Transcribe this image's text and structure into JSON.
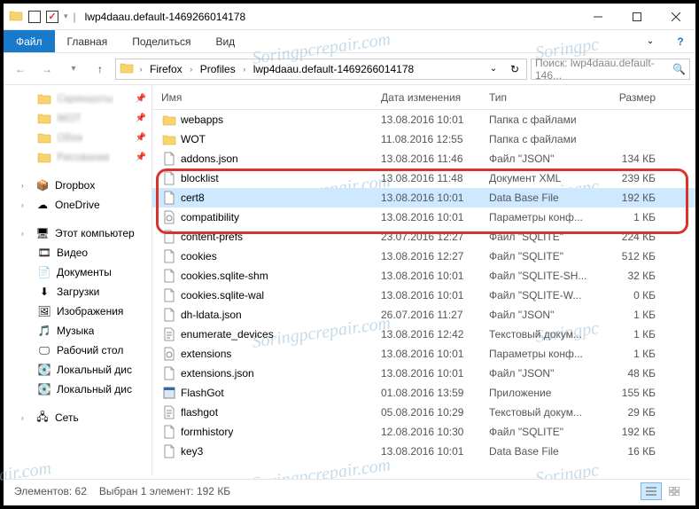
{
  "window": {
    "title": "lwp4daau.default-1469266014178"
  },
  "ribbon": {
    "file": "Файл",
    "tabs": [
      "Главная",
      "Поделиться",
      "Вид"
    ]
  },
  "breadcrumbs": [
    "Firefox",
    "Profiles",
    "lwp4daau.default-1469266014178"
  ],
  "search": {
    "placeholder": "Поиск: lwp4daau.default-146..."
  },
  "sidebar": {
    "quick": [
      {
        "label": "Скриншоты",
        "icon": "folder",
        "blur": true,
        "pin": true
      },
      {
        "label": "WOT",
        "icon": "folder",
        "blur": true,
        "pin": true
      },
      {
        "label": "Обои",
        "icon": "folder",
        "blur": true,
        "pin": true
      },
      {
        "label": "Рисование",
        "icon": "folder",
        "blur": true,
        "pin": true
      }
    ],
    "cloud": [
      {
        "label": "Dropbox",
        "icon": "dropbox"
      },
      {
        "label": "OneDrive",
        "icon": "onedrive"
      }
    ],
    "pc": {
      "label": "Этот компьютер"
    },
    "pc_items": [
      {
        "label": "Видео",
        "icon": "video"
      },
      {
        "label": "Документы",
        "icon": "docs"
      },
      {
        "label": "Загрузки",
        "icon": "downloads"
      },
      {
        "label": "Изображения",
        "icon": "images"
      },
      {
        "label": "Музыка",
        "icon": "music"
      },
      {
        "label": "Рабочий стол",
        "icon": "desktop"
      },
      {
        "label": "Локальный дис",
        "icon": "disk"
      },
      {
        "label": "Локальный дис",
        "icon": "disk"
      }
    ],
    "network": {
      "label": "Сеть"
    }
  },
  "columns": {
    "name": "Имя",
    "date": "Дата изменения",
    "type": "Тип",
    "size": "Размер"
  },
  "files": [
    {
      "name": "webapps",
      "date": "13.08.2016 10:01",
      "type": "Папка с файлами",
      "size": "",
      "icon": "folder"
    },
    {
      "name": "WOT",
      "date": "11.08.2016 12:55",
      "type": "Папка с файлами",
      "size": "",
      "icon": "folder"
    },
    {
      "name": "addons.json",
      "date": "13.08.2016 11:46",
      "type": "Файл \"JSON\"",
      "size": "134 КБ",
      "icon": "file"
    },
    {
      "name": "blocklist",
      "date": "13.08.2016 11:48",
      "type": "Документ XML",
      "size": "239 КБ",
      "icon": "file"
    },
    {
      "name": "cert8",
      "date": "13.08.2016 10:01",
      "type": "Data Base File",
      "size": "192 КБ",
      "icon": "file",
      "selected": true
    },
    {
      "name": "compatibility",
      "date": "13.08.2016 10:01",
      "type": "Параметры конф...",
      "size": "1 КБ",
      "icon": "ini"
    },
    {
      "name": "content-prefs",
      "date": "23.07.2016 12:27",
      "type": "Файл \"SQLITE\"",
      "size": "224 КБ",
      "icon": "file"
    },
    {
      "name": "cookies",
      "date": "13.08.2016 12:27",
      "type": "Файл \"SQLITE\"",
      "size": "512 КБ",
      "icon": "file"
    },
    {
      "name": "cookies.sqlite-shm",
      "date": "13.08.2016 10:01",
      "type": "Файл \"SQLITE-SH...",
      "size": "32 КБ",
      "icon": "file"
    },
    {
      "name": "cookies.sqlite-wal",
      "date": "13.08.2016 10:01",
      "type": "Файл \"SQLITE-W...",
      "size": "0 КБ",
      "icon": "file"
    },
    {
      "name": "dh-ldata.json",
      "date": "26.07.2016 11:27",
      "type": "Файл \"JSON\"",
      "size": "1 КБ",
      "icon": "file"
    },
    {
      "name": "enumerate_devices",
      "date": "13.08.2016 12:42",
      "type": "Текстовый докум...",
      "size": "1 КБ",
      "icon": "txt"
    },
    {
      "name": "extensions",
      "date": "13.08.2016 10:01",
      "type": "Параметры конф...",
      "size": "1 КБ",
      "icon": "ini"
    },
    {
      "name": "extensions.json",
      "date": "13.08.2016 10:01",
      "type": "Файл \"JSON\"",
      "size": "48 КБ",
      "icon": "file"
    },
    {
      "name": "FlashGot",
      "date": "01.08.2016 13:59",
      "type": "Приложение",
      "size": "155 КБ",
      "icon": "exe"
    },
    {
      "name": "flashgot",
      "date": "05.08.2016 10:29",
      "type": "Текстовый докум...",
      "size": "29 КБ",
      "icon": "txt"
    },
    {
      "name": "formhistory",
      "date": "12.08.2016 10:30",
      "type": "Файл \"SQLITE\"",
      "size": "192 КБ",
      "icon": "file"
    },
    {
      "name": "key3",
      "date": "13.08.2016 10:01",
      "type": "Data Base File",
      "size": "16 КБ",
      "icon": "file"
    }
  ],
  "statusbar": {
    "count_label": "Элементов: 62",
    "selection_label": "Выбран 1 элемент: 192 КБ"
  }
}
